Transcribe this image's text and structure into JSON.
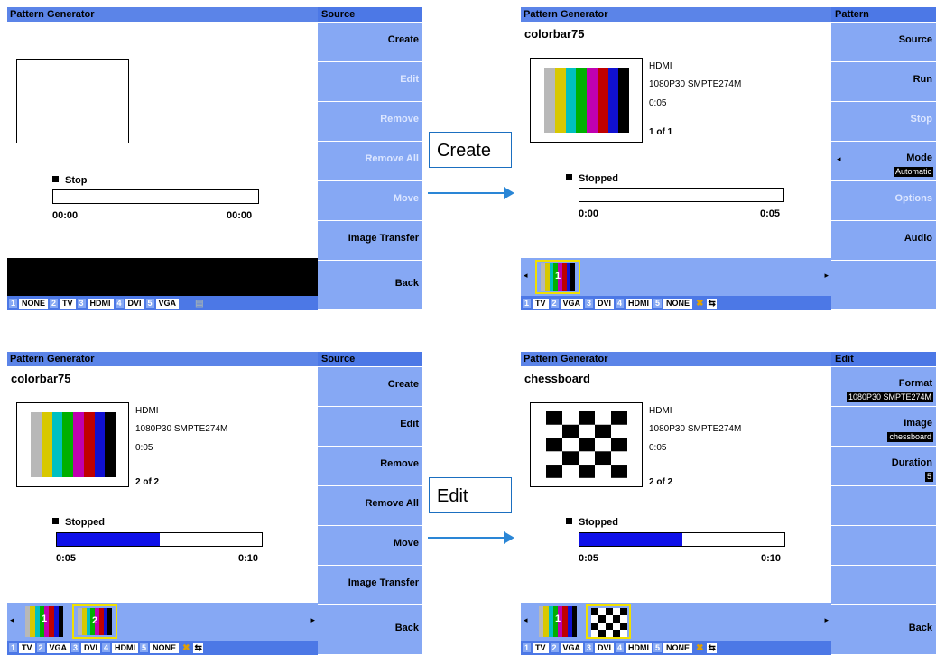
{
  "colorbar": [
    "#b8b8b8",
    "#d8c800",
    "#00c0c0",
    "#00b000",
    "#c000b0",
    "#c00000",
    "#1010d0",
    "#000000"
  ],
  "panels": {
    "p1": {
      "title": "Pattern Generator",
      "side_title": "Source",
      "buttons": [
        {
          "label": "Create",
          "enabled": true
        },
        {
          "label": "Edit",
          "enabled": false
        },
        {
          "label": "Remove",
          "enabled": false
        },
        {
          "label": "Remove All",
          "enabled": false
        },
        {
          "label": "Move",
          "enabled": false
        },
        {
          "label": "Image Transfer",
          "enabled": true
        },
        {
          "label": "Back",
          "enabled": true
        }
      ],
      "status": "Stop",
      "progress_fraction": 0,
      "time_start": "00:00",
      "time_end": "00:00",
      "tabs": [
        {
          "n": "1",
          "t": "NONE"
        },
        {
          "n": "2",
          "t": "TV"
        },
        {
          "n": "3",
          "t": "HDMI"
        },
        {
          "n": "4",
          "t": "DVI"
        },
        {
          "n": "5",
          "t": "VGA"
        }
      ]
    },
    "p2": {
      "title": "Pattern Generator",
      "side_title": "Pattern",
      "pattern_name": "colorbar75",
      "interface": "HDMI",
      "format": "1080P30 SMPTE274M",
      "duration": "0:05",
      "count": "1 of 1",
      "buttons": [
        {
          "label": "Source",
          "enabled": true
        },
        {
          "label": "Run",
          "enabled": true
        },
        {
          "label": "Stop",
          "enabled": false
        },
        {
          "label": "Mode",
          "enabled": true,
          "value": "Automatic"
        },
        {
          "label": "Options",
          "enabled": false
        },
        {
          "label": "Audio",
          "enabled": true
        },
        {
          "label": "",
          "enabled": true
        }
      ],
      "status": "Stopped",
      "progress_fraction": 0,
      "time_start": "0:00",
      "time_end": "0:05",
      "thumbs": [
        {
          "num": "1",
          "kind": "colorbar",
          "selected": true
        }
      ],
      "tabs": [
        {
          "n": "1",
          "t": "TV"
        },
        {
          "n": "2",
          "t": "VGA"
        },
        {
          "n": "3",
          "t": "DVI"
        },
        {
          "n": "4",
          "t": "HDMI"
        },
        {
          "n": "5",
          "t": "NONE"
        }
      ]
    },
    "p3": {
      "title": "Pattern Generator",
      "side_title": "Source",
      "pattern_name": "colorbar75",
      "interface": "HDMI",
      "format": "1080P30 SMPTE274M",
      "duration": "0:05",
      "count": "2 of 2",
      "buttons": [
        {
          "label": "Create",
          "enabled": true
        },
        {
          "label": "Edit",
          "enabled": true
        },
        {
          "label": "Remove",
          "enabled": true
        },
        {
          "label": "Remove All",
          "enabled": true
        },
        {
          "label": "Move",
          "enabled": true
        },
        {
          "label": "Image Transfer",
          "enabled": true
        },
        {
          "label": "Back",
          "enabled": true
        }
      ],
      "status": "Stopped",
      "progress_fraction": 0.5,
      "time_start": "0:05",
      "time_end": "0:10",
      "thumbs": [
        {
          "num": "1",
          "kind": "colorbar",
          "selected": false
        },
        {
          "num": "2",
          "kind": "colorbar",
          "selected": true
        }
      ],
      "tabs": [
        {
          "n": "1",
          "t": "TV"
        },
        {
          "n": "2",
          "t": "VGA"
        },
        {
          "n": "3",
          "t": "DVI"
        },
        {
          "n": "4",
          "t": "HDMI"
        },
        {
          "n": "5",
          "t": "NONE"
        }
      ]
    },
    "p4": {
      "title": "Pattern Generator",
      "side_title": "Edit",
      "pattern_name": "chessboard",
      "interface": "HDMI",
      "format": "1080P30 SMPTE274M",
      "duration": "0:05",
      "count": "2 of 2",
      "buttons": [
        {
          "label": "Format",
          "enabled": true,
          "value": "1080P30 SMPTE274M"
        },
        {
          "label": "Image",
          "enabled": true,
          "value": "chessboard"
        },
        {
          "label": "Duration",
          "enabled": true,
          "value": "5"
        },
        {
          "label": "",
          "enabled": true
        },
        {
          "label": "",
          "enabled": true
        },
        {
          "label": "",
          "enabled": true
        },
        {
          "label": "Back",
          "enabled": true
        }
      ],
      "status": "Stopped",
      "progress_fraction": 0.5,
      "time_start": "0:05",
      "time_end": "0:10",
      "thumbs": [
        {
          "num": "1",
          "kind": "colorbar",
          "selected": false
        },
        {
          "num": "2",
          "kind": "chess",
          "selected": true
        }
      ],
      "tabs": [
        {
          "n": "1",
          "t": "TV"
        },
        {
          "n": "2",
          "t": "VGA"
        },
        {
          "n": "3",
          "t": "DVI"
        },
        {
          "n": "4",
          "t": "HDMI"
        },
        {
          "n": "5",
          "t": "NONE"
        }
      ]
    }
  },
  "callouts": {
    "create": "Create",
    "edit": "Edit"
  }
}
